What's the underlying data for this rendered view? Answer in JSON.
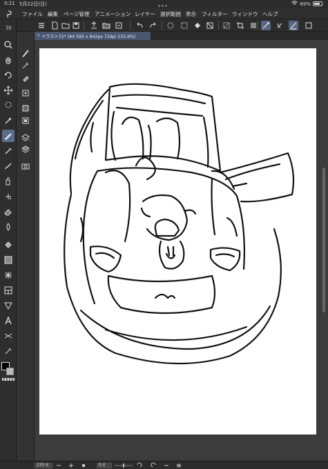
{
  "status": {
    "time": "0:21",
    "date": "5月22日(日)",
    "battery": "69%"
  },
  "menu": {
    "items": [
      "ファイル",
      "編集",
      "ページ管理",
      "アニメーション",
      "レイヤー",
      "選択範囲",
      "表示",
      "フィルター",
      "ウィンドウ",
      "ヘルプ"
    ]
  },
  "tab": {
    "close": "×",
    "title": "イラスト72* (A4 595 x 842px 72dpi 233.6%)"
  },
  "bottom": {
    "zoom": "233.6",
    "rotation": "0.0"
  },
  "icons": {
    "command_bar": [
      "menu-icon",
      "new-file-icon",
      "open-icon",
      "save-icon",
      "export-icon",
      "undo-icon",
      "redo-icon",
      "clear-icon",
      "select-all-icon",
      "fill-icon",
      "transform-icon",
      "deselect-icon",
      "crop-icon",
      "snap-ruler-icon",
      "snap-special-icon",
      "snap-grid-icon"
    ],
    "tools_primary": [
      "zoom-icon",
      "hand-icon",
      "rotate-icon",
      "move-icon",
      "lasso-icon",
      "eyedropper-icon",
      "pen-icon",
      "pencil-icon",
      "brush-icon",
      "airbrush-icon",
      "decoration-icon",
      "eraser-icon",
      "blend-icon",
      "fill-bucket-icon",
      "gradient-icon",
      "dot-icon",
      "frame-icon",
      "ruler-icon",
      "text-icon",
      "balloon-icon",
      "correction-icon"
    ],
    "tools_secondary": [
      "subtool-icon",
      "layer-move-icon",
      "layer-select-icon",
      "layer-add-icon",
      "layer-property-icon",
      "mask-icon",
      "layer-icon",
      "layer-stack-icon",
      "camera-icon"
    ]
  },
  "colors": {
    "main": "#000000",
    "sub": "#bbbbbb",
    "accent": "#5b6b8c"
  }
}
